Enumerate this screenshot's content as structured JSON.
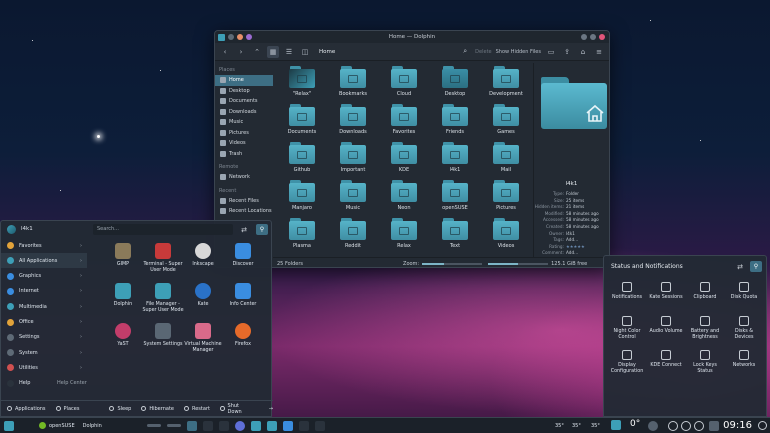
{
  "dolphin": {
    "title": "Home — Dolphin",
    "breadcrumb": "Home",
    "delete_label": "Delete",
    "hidden_files_label": "Show Hidden Files",
    "places_header": "Places",
    "places": [
      "Home",
      "Desktop",
      "Documents",
      "Downloads",
      "Music",
      "Pictures",
      "Videos",
      "Trash"
    ],
    "remote_header": "Remote",
    "remote": [
      "Network"
    ],
    "recent_header": "Recent",
    "recent": [
      "Recent Files",
      "Recent Locations"
    ],
    "folders": [
      "\"Relax\"",
      "Bookmarks",
      "Cloud",
      "Desktop",
      "Development",
      "Documents",
      "Downloads",
      "Favorites",
      "Friends",
      "Games",
      "Github",
      "Important",
      "KDE",
      "l4k1",
      "Mail",
      "Manjaro",
      "Music",
      "Neon",
      "openSUSE",
      "Pictures",
      "Plasma",
      "Reddit",
      "Relax",
      "Text",
      "Videos"
    ],
    "info": {
      "name": "l4k1",
      "rows": [
        {
          "k": "Type:",
          "v": "Folder"
        },
        {
          "k": "Size:",
          "v": "25 items"
        },
        {
          "k": "Hidden items:",
          "v": "21 items"
        },
        {
          "k": "Modified:",
          "v": "58 minutes ago"
        },
        {
          "k": "Accessed:",
          "v": "58 minutes ago"
        },
        {
          "k": "Created:",
          "v": "58 minutes ago"
        },
        {
          "k": "Owner:",
          "v": "l4k1"
        },
        {
          "k": "Tags:",
          "v": "Add..."
        },
        {
          "k": "Rating:",
          "v": "★★★★★"
        },
        {
          "k": "Comment:",
          "v": "Add..."
        }
      ]
    },
    "status_left": "25 Folders",
    "zoom_label": "Zoom:",
    "free_space": "125.1 GiB free"
  },
  "menu": {
    "user": "l4k1",
    "search_placeholder": "Search...",
    "categories": [
      "Favorites",
      "All Applications",
      "Graphics",
      "Internet",
      "Multimedia",
      "Office",
      "Settings",
      "System",
      "Utilities",
      "Help"
    ],
    "help_center": "Help Center",
    "apps": [
      "GIMP",
      "Terminal - Super User Mode",
      "Inkscape",
      "Discover",
      "Dolphin",
      "File Manager - Super User Mode",
      "Kate",
      "Info Center",
      "YaST",
      "System Settings",
      "Virtual Machine Manager",
      "Firefox"
    ],
    "footer": [
      "Applications",
      "Places",
      "Sleep",
      "Hibernate",
      "Restart",
      "Shut Down"
    ]
  },
  "notifications": {
    "title": "Status and Notifications",
    "items": [
      "Notifications",
      "Kate Sessions",
      "Clipboard",
      "Disk Quota",
      "Night Color Control",
      "Audio Volume",
      "Battery and Brightness",
      "Disks & Devices",
      "Display Configuration",
      "KDE Connect",
      "Lock Keys Status",
      "Networks"
    ]
  },
  "taskbar": {
    "items": [
      "openSUSE",
      "Dolphin"
    ],
    "temps": [
      "35°",
      "35°",
      "35°"
    ],
    "weather": "0°",
    "clock": "09:16"
  }
}
